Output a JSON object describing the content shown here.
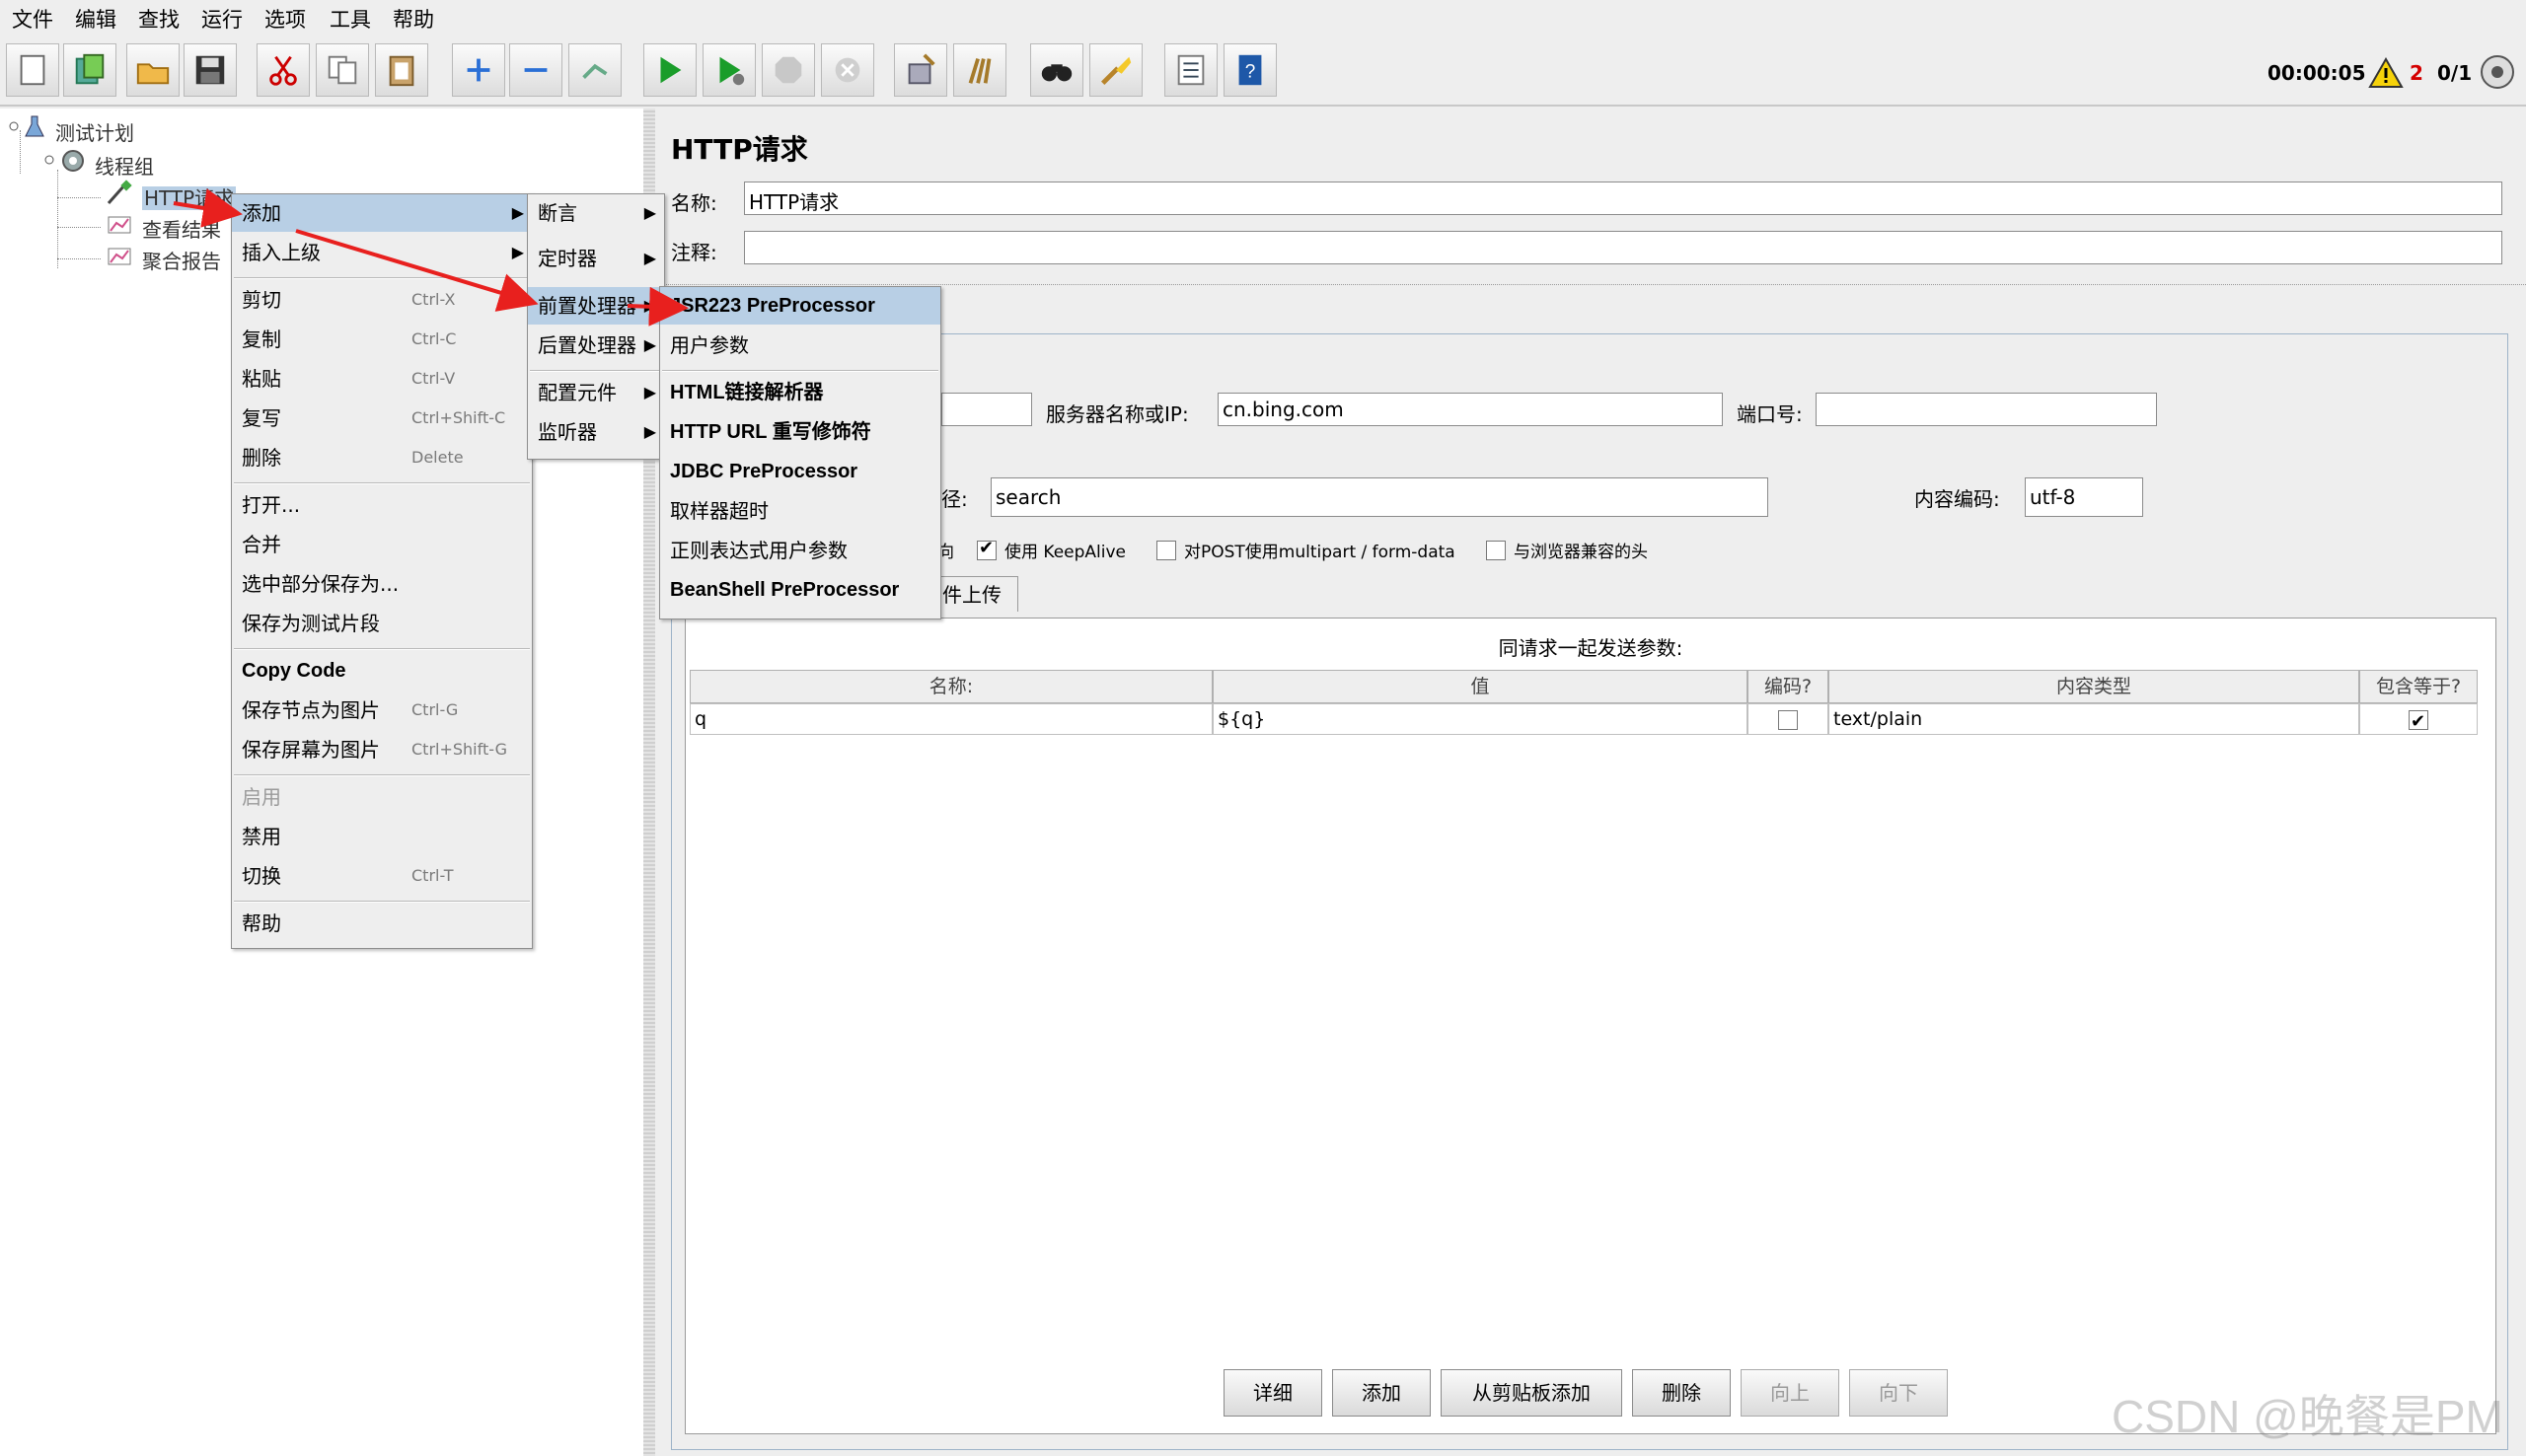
{
  "menubar": [
    "文件",
    "编辑",
    "查找",
    "运行",
    "选项",
    "工具",
    "帮助"
  ],
  "toolbar": {
    "icons": [
      "new-icon",
      "templates-icon",
      "open-icon",
      "save-icon",
      "cut-icon",
      "copy-icon",
      "paste-icon",
      "expand-icon",
      "collapse-icon",
      "toggle-icon",
      "start-icon",
      "start-no-pause-icon",
      "stop-icon",
      "shutdown-icon",
      "clear-icon",
      "clear-all-icon",
      "search-icon",
      "reset-search-icon",
      "function-helper-icon",
      "help-icon"
    ],
    "timer": "00:00:05",
    "warnings": "2",
    "threads": "0/1"
  },
  "tree": {
    "plan": "测试计划",
    "group": "线程组",
    "sampler": "HTTP请求",
    "listener1": "查看结果",
    "listener2": "聚合报告"
  },
  "context_menu": {
    "add": "添加",
    "insert_parent": "插入上级",
    "items": [
      {
        "label": "剪切",
        "shortcut": "Ctrl-X"
      },
      {
        "label": "复制",
        "shortcut": "Ctrl-C"
      },
      {
        "label": "粘贴",
        "shortcut": "Ctrl-V"
      },
      {
        "label": "复写",
        "shortcut": "Ctrl+Shift-C"
      },
      {
        "label": "删除",
        "shortcut": "Delete"
      }
    ],
    "group2": [
      "打开...",
      "合并",
      "选中部分保存为...",
      "保存为测试片段"
    ],
    "copy_code": "Copy Code",
    "save_node_img": {
      "label": "保存节点为图片",
      "shortcut": "Ctrl-G"
    },
    "save_screen_img": {
      "label": "保存屏幕为图片",
      "shortcut": "Ctrl+Shift-G"
    },
    "enable": "启用",
    "disable": "禁用",
    "toggle": {
      "label": "切换",
      "shortcut": "Ctrl-T"
    },
    "help": "帮助"
  },
  "add_submenu": [
    "断言",
    "定时器",
    "前置处理器",
    "后置处理器",
    "配置元件",
    "监听器"
  ],
  "pre_submenu": [
    "JSR223 PreProcessor",
    "用户参数",
    "HTML链接解析器",
    "HTTP URL 重写修饰符",
    "JDBC PreProcessor",
    "取样器超时",
    "正则表达式用户参数",
    "BeanShell PreProcessor"
  ],
  "panel": {
    "title": "HTTP请求",
    "name_label": "名称:",
    "name_value": "HTTP请求",
    "comment_label": "注释:",
    "comment_value": "",
    "server_label": "服务器名称或IP:",
    "server_value": "cn.bing.com",
    "port_label": "端口号:",
    "port_value": "",
    "path_label_partial": "径:",
    "path_value": "search",
    "encoding_label": "内容编码:",
    "encoding_value": "utf-8",
    "opt_redirect_partial": "向",
    "opt_keepalive": "使用 KeepAlive",
    "opt_multipart": "对POST使用multipart / form-data",
    "opt_browser_headers": "与浏览器兼容的头",
    "tab_upload_partial": "件上传"
  },
  "params_table": {
    "caption": "同请求一起发送参数:",
    "headers": [
      "名称:",
      "值",
      "编码?",
      "内容类型",
      "包含等于?"
    ],
    "rows": [
      {
        "name": "q",
        "value": "${q}",
        "encode": false,
        "content_type": "text/plain",
        "include_equals": true
      }
    ]
  },
  "buttons": [
    "详细",
    "添加",
    "从剪贴板添加",
    "删除",
    "向上",
    "向下"
  ],
  "watermark": "CSDN @晚餐是PM",
  "colors": {
    "selection": "#b8cfe5",
    "arrow": "#e8201e",
    "warning": "#d40000"
  }
}
